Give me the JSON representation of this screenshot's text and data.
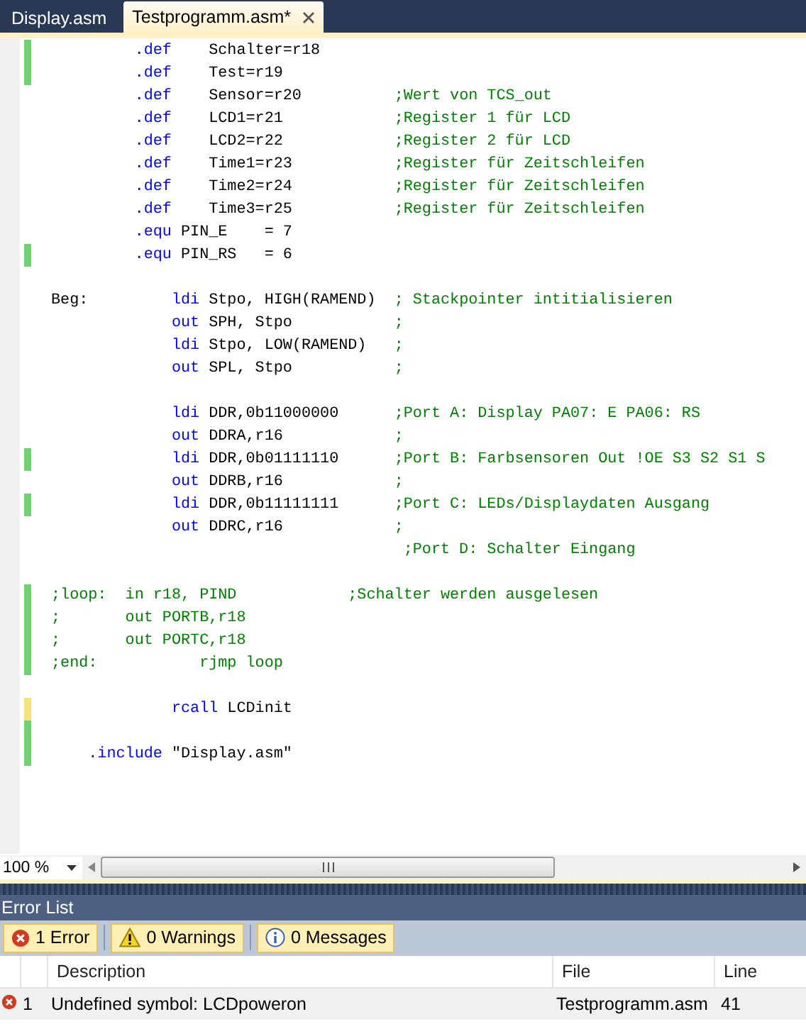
{
  "tabs": [
    {
      "label": "Display.asm",
      "selected": false
    },
    {
      "label": "Testprogramm.asm*",
      "selected": true
    }
  ],
  "editor": {
    "lines": [
      {
        "changed": true,
        "saved": true,
        "tokens": [
          {
            "kind": "keyword",
            "text": "         .def"
          },
          {
            "kind": "plain",
            "text": "    Schalter=r18"
          }
        ]
      },
      {
        "changed": true,
        "saved": true,
        "tokens": [
          {
            "kind": "keyword",
            "text": "         .def"
          },
          {
            "kind": "plain",
            "text": "    Test=r19"
          }
        ]
      },
      {
        "changed": false,
        "tokens": [
          {
            "kind": "keyword",
            "text": "         .def"
          },
          {
            "kind": "plain",
            "text": "    Sensor=r20          "
          },
          {
            "kind": "comment",
            "text": ";Wert von TCS_out"
          }
        ]
      },
      {
        "changed": false,
        "tokens": [
          {
            "kind": "keyword",
            "text": "         .def"
          },
          {
            "kind": "plain",
            "text": "    LCD1=r21            "
          },
          {
            "kind": "comment",
            "text": ";Register 1 für LCD"
          }
        ]
      },
      {
        "changed": false,
        "tokens": [
          {
            "kind": "keyword",
            "text": "         .def"
          },
          {
            "kind": "plain",
            "text": "    LCD2=r22            "
          },
          {
            "kind": "comment",
            "text": ";Register 2 für LCD"
          }
        ]
      },
      {
        "changed": false,
        "tokens": [
          {
            "kind": "keyword",
            "text": "         .def"
          },
          {
            "kind": "plain",
            "text": "    Time1=r23           "
          },
          {
            "kind": "comment",
            "text": ";Register für Zeitschleifen"
          }
        ]
      },
      {
        "changed": false,
        "tokens": [
          {
            "kind": "keyword",
            "text": "         .def"
          },
          {
            "kind": "plain",
            "text": "    Time2=r24           "
          },
          {
            "kind": "comment",
            "text": ";Register für Zeitschleifen"
          }
        ]
      },
      {
        "changed": false,
        "tokens": [
          {
            "kind": "keyword",
            "text": "         .def"
          },
          {
            "kind": "plain",
            "text": "    Time3=r25           "
          },
          {
            "kind": "comment",
            "text": ";Register für Zeitschleifen"
          }
        ]
      },
      {
        "changed": false,
        "tokens": [
          {
            "kind": "keyword",
            "text": "         .equ"
          },
          {
            "kind": "plain",
            "text": " PIN_E    = 7"
          }
        ]
      },
      {
        "changed": true,
        "saved": true,
        "tokens": [
          {
            "kind": "keyword",
            "text": "         .equ"
          },
          {
            "kind": "plain",
            "text": " PIN_RS   = 6"
          }
        ]
      },
      {
        "changed": false
      },
      {
        "changed": false,
        "tokens": [
          {
            "kind": "plain",
            "text": "Beg:         "
          },
          {
            "kind": "keyword",
            "text": "ldi"
          },
          {
            "kind": "plain",
            "text": " Stpo, HIGH(RAMEND)  "
          },
          {
            "kind": "comment",
            "text": "; Stackpointer intitialisieren"
          }
        ]
      },
      {
        "changed": false,
        "tokens": [
          {
            "kind": "keyword",
            "text": "             out"
          },
          {
            "kind": "plain",
            "text": " SPH, Stpo           "
          },
          {
            "kind": "comment",
            "text": ";"
          }
        ]
      },
      {
        "changed": false,
        "tokens": [
          {
            "kind": "keyword",
            "text": "             ldi"
          },
          {
            "kind": "plain",
            "text": " Stpo, LOW(RAMEND)   "
          },
          {
            "kind": "comment",
            "text": ";"
          }
        ]
      },
      {
        "changed": false,
        "tokens": [
          {
            "kind": "keyword",
            "text": "             out"
          },
          {
            "kind": "plain",
            "text": " SPL, Stpo           "
          },
          {
            "kind": "comment",
            "text": ";"
          }
        ]
      },
      {
        "changed": false
      },
      {
        "changed": false,
        "tokens": [
          {
            "kind": "keyword",
            "text": "             ldi"
          },
          {
            "kind": "plain",
            "text": " DDR,0b11000000      "
          },
          {
            "kind": "comment",
            "text": ";Port A: Display PA07: E PA06: RS"
          }
        ]
      },
      {
        "changed": false,
        "tokens": [
          {
            "kind": "keyword",
            "text": "             out"
          },
          {
            "kind": "plain",
            "text": " DDRA,r16            "
          },
          {
            "kind": "comment",
            "text": ";"
          }
        ]
      },
      {
        "changed": true,
        "saved": true,
        "tokens": [
          {
            "kind": "keyword",
            "text": "             ldi"
          },
          {
            "kind": "plain",
            "text": " DDR,0b01111110      "
          },
          {
            "kind": "comment",
            "text": ";Port B: Farbsensoren Out !OE S3 S2 S1 S"
          }
        ]
      },
      {
        "changed": false,
        "tokens": [
          {
            "kind": "keyword",
            "text": "             out"
          },
          {
            "kind": "plain",
            "text": " DDRB,r16            "
          },
          {
            "kind": "comment",
            "text": ";"
          }
        ]
      },
      {
        "changed": true,
        "saved": true,
        "tokens": [
          {
            "kind": "keyword",
            "text": "             ldi"
          },
          {
            "kind": "plain",
            "text": " DDR,0b11111111      "
          },
          {
            "kind": "comment",
            "text": ";Port C: LEDs/Displaydaten Ausgang"
          }
        ]
      },
      {
        "changed": false,
        "tokens": [
          {
            "kind": "keyword",
            "text": "             out"
          },
          {
            "kind": "plain",
            "text": " DDRC,r16            "
          },
          {
            "kind": "comment",
            "text": ";"
          }
        ]
      },
      {
        "changed": false,
        "tokens": [
          {
            "kind": "comment",
            "text": "                                      ;Port D: Schalter Eingang"
          }
        ]
      },
      {
        "changed": false
      },
      {
        "changed": true,
        "saved": true,
        "tokens": [
          {
            "kind": "comment",
            "text": ";loop:  in r18, PIND            ;Schalter werden ausgelesen"
          }
        ]
      },
      {
        "changed": true,
        "saved": true,
        "tokens": [
          {
            "kind": "comment",
            "text": ";       out PORTB,r18"
          }
        ]
      },
      {
        "changed": true,
        "saved": true,
        "tokens": [
          {
            "kind": "comment",
            "text": ";       out PORTC,r18"
          }
        ]
      },
      {
        "changed": true,
        "saved": true,
        "tokens": [
          {
            "kind": "comment",
            "text": ";end:           rjmp loop"
          }
        ]
      },
      {
        "changed": false
      },
      {
        "changed": true,
        "saved": false,
        "tokens": [
          {
            "kind": "keyword",
            "text": "             rcall"
          },
          {
            "kind": "plain",
            "text": " LCDinit"
          }
        ]
      },
      {
        "changed": true,
        "saved": true
      },
      {
        "changed": true,
        "saved": true,
        "tokens": [
          {
            "kind": "keyword",
            "text": "    .include"
          },
          {
            "kind": "plain",
            "text": " \"Display.asm\""
          }
        ]
      }
    ],
    "zoom": "100 %"
  },
  "error_list": {
    "title": "Error List",
    "filters": [
      {
        "kind": "error",
        "label": "1 Error",
        "selected": true
      },
      {
        "kind": "warning",
        "label": "0 Warnings",
        "selected": true
      },
      {
        "kind": "message",
        "label": "0 Messages",
        "selected": true
      }
    ],
    "columns": [
      "Description",
      "File",
      "Line"
    ],
    "rows": [
      {
        "kind": "error",
        "number": "1",
        "description": "Undefined symbol: LCDpoweron",
        "file": "Testprogramm.asm",
        "line": "41"
      }
    ]
  }
}
